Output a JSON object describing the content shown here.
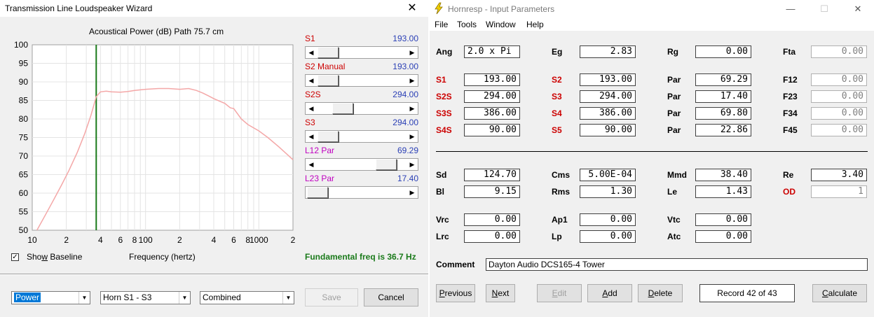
{
  "wizard": {
    "title": "Transmission Line Loudspeaker Wizard",
    "close_glyph": "✕",
    "chart_title": "Acoustical Power (dB)   Path 75.7 cm",
    "sliders": [
      {
        "label": "S1",
        "extra": "",
        "value": "193.00",
        "color": "#cc0000"
      },
      {
        "label": "S2",
        "extra": "Manual",
        "value": "193.00",
        "color": "#cc0000"
      },
      {
        "label": "S2S",
        "extra": "",
        "value": "294.00",
        "color": "#cc0000"
      },
      {
        "label": "S3",
        "extra": "",
        "value": "294.00",
        "color": "#cc0000"
      },
      {
        "label": "L12",
        "extra": "Par",
        "value": "69.29",
        "color": "#c000c0"
      },
      {
        "label": "L23",
        "extra": "Par",
        "value": "17.40",
        "color": "#c000c0"
      }
    ],
    "show_baseline_label": "Show Baseline",
    "show_baseline_checked": "✓",
    "freq_axis_label": "Frequency (hertz)",
    "fundamental": "Fundamental freq is 36.7 Hz",
    "combo_power": "Power",
    "combo_horn": "Horn S1 - S3",
    "combo_combined": "Combined",
    "save_label": "Save",
    "cancel_label": "Cancel"
  },
  "chart_data": {
    "type": "line",
    "title": "Acoustical Power (dB)   Path 75.7 cm",
    "xlabel": "Frequency (hertz)",
    "ylabel": "",
    "xscale": "log",
    "xlim": [
      10,
      2000
    ],
    "ylim": [
      50,
      100
    ],
    "y_ticks": [
      "100",
      "95",
      "90",
      "85",
      "80",
      "75",
      "70",
      "65",
      "60",
      "55",
      "50"
    ],
    "x_tick_labels": [
      {
        "f": 10,
        "t": "10"
      },
      {
        "f": 20,
        "t": "2"
      },
      {
        "f": 40,
        "t": "4"
      },
      {
        "f": 60,
        "t": "6"
      },
      {
        "f": 80,
        "t": "8"
      },
      {
        "f": 100,
        "t": "100"
      },
      {
        "f": 200,
        "t": "2"
      },
      {
        "f": 400,
        "t": "4"
      },
      {
        "f": 600,
        "t": "6"
      },
      {
        "f": 800,
        "t": "8"
      },
      {
        "f": 1000,
        "t": "1000"
      },
      {
        "f": 2000,
        "t": "2"
      }
    ],
    "grid": true,
    "marker_freq": 36.7,
    "line_color": "#f4a7a7",
    "marker_color": "#1a7a1a",
    "series": [
      {
        "x": [
          11,
          13,
          15,
          18,
          21,
          25,
          29,
          33,
          36.7,
          40,
          45,
          50,
          60,
          70,
          80,
          100,
          130,
          160,
          200,
          240,
          280,
          320,
          360,
          400,
          450,
          500,
          560,
          600,
          700,
          800,
          1000,
          1200,
          1500,
          1800,
          2000
        ],
        "y": [
          50,
          54,
          57.5,
          62,
          66,
          71,
          76,
          81,
          86,
          87.3,
          87.5,
          87.3,
          87.2,
          87.4,
          87.7,
          88,
          88.2,
          88.2,
          88,
          88.2,
          87.7,
          87,
          86.2,
          85.5,
          84.8,
          84.2,
          83,
          82.8,
          80,
          78.5,
          76.8,
          75,
          72.5,
          70.3,
          69
        ]
      }
    ]
  },
  "hornresp": {
    "title": "Hornresp - Input Parameters",
    "min_glyph": "—",
    "max_glyph": "☐",
    "close_glyph": "✕",
    "menu": [
      "File",
      "Tools",
      "Window",
      "Help"
    ],
    "colors": {
      "red_label": "#cc0000"
    },
    "rows_top": [
      {
        "l1": "Ang",
        "v1": "2.0 x Pi",
        "l2": "Eg",
        "v2": "2.83",
        "l3": "Rg",
        "v3": "0.00",
        "l4": "Fta",
        "v4": "0.00"
      },
      {
        "l1": "S1",
        "v1": "193.00",
        "l2": "S2",
        "v2": "193.00",
        "l3": "Par",
        "v3": "69.29",
        "l4": "F12",
        "v4": "0.00"
      },
      {
        "l1": "S2S",
        "v1": "294.00",
        "l2": "S3",
        "v2": "294.00",
        "l3": "Par",
        "v3": "17.40",
        "l4": "F23",
        "v4": "0.00"
      },
      {
        "l1": "S3S",
        "v1": "386.00",
        "l2": "S4",
        "v2": "386.00",
        "l3": "Par",
        "v3": "69.80",
        "l4": "F34",
        "v4": "0.00"
      },
      {
        "l1": "S4S",
        "v1": "90.00",
        "l2": "S5",
        "v2": "90.00",
        "l3": "Par",
        "v3": "22.86",
        "l4": "F45",
        "v4": "0.00"
      }
    ],
    "rows_driver": [
      {
        "l1": "Sd",
        "v1": "124.70",
        "l2": "Cms",
        "v2": "5.00E-04",
        "l3": "Mmd",
        "v3": "38.40",
        "l4": "Re",
        "v4": "3.40"
      },
      {
        "l1": "Bl",
        "v1": "9.15",
        "l2": "Rms",
        "v2": "1.30",
        "l3": "Le",
        "v3": "1.43",
        "l4": "OD",
        "v4": "1"
      }
    ],
    "rows_chamber": [
      {
        "l1": "Vrc",
        "v1": "0.00",
        "l2": "Ap1",
        "v2": "0.00",
        "l3": "Vtc",
        "v3": "0.00"
      },
      {
        "l1": "Lrc",
        "v1": "0.00",
        "l2": "Lp",
        "v2": "0.00",
        "l3": "Atc",
        "v3": "0.00"
      }
    ],
    "comment_label": "Comment",
    "comment_value": "Dayton Audio DCS165-4 Tower",
    "buttons": {
      "previous": "Previous",
      "next": "Next",
      "edit": "Edit",
      "add": "Add",
      "delete": "Delete",
      "record": "Record 42 of 43",
      "calculate": "Calculate"
    }
  }
}
